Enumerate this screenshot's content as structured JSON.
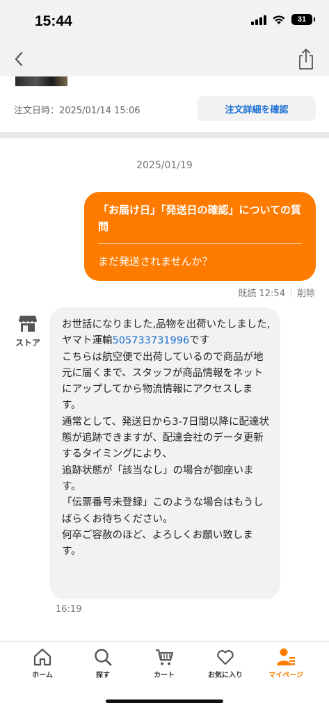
{
  "status_bar": {
    "time": "15:44",
    "battery": "31"
  },
  "order": {
    "date_label": "注文日時：2025/01/14 15:06",
    "detail_button": "注文詳細を確認"
  },
  "chat": {
    "date": "2025/01/19",
    "outgoing": {
      "title": "「お届け日」「発送日の確認」についての質問",
      "body": "まだ発送されませんか？",
      "read_status": "既読 12:54",
      "delete_label": "削除"
    },
    "store_label": "ストア",
    "incoming": {
      "line1_pre": "お世話になりました,品物を出荷いたしました,ヤマト運輸",
      "tracking_number": "505733731996",
      "line1_post": "です",
      "paragraphs": [
        "こちらは航空便で出荷しているので商品が地元に届くまで、スタッフが商品情報をネットにアップしてから物流情報にアクセスします。",
        "通常として、発送日から3-7日間以降に配達状態が追跡できますが、配達会社のデータ更新するタイミングにより、",
        "追跡状態が「該当なし」の場合が御座います。",
        "「伝票番号未登録」このような場合はもうしばらくお待ちください。",
        "何卒ご容赦のほど、よろしくお願い致します。"
      ],
      "time": "16:19"
    }
  },
  "tabs": [
    {
      "label": "ホーム",
      "icon": "home-icon"
    },
    {
      "label": "探す",
      "icon": "search-icon"
    },
    {
      "label": "カート",
      "icon": "cart-icon"
    },
    {
      "label": "お気に入り",
      "icon": "heart-icon"
    },
    {
      "label": "マイページ",
      "icon": "person-icon",
      "active": true
    }
  ],
  "colors": {
    "accent": "#ff7b00",
    "link": "#1a6fd4"
  }
}
